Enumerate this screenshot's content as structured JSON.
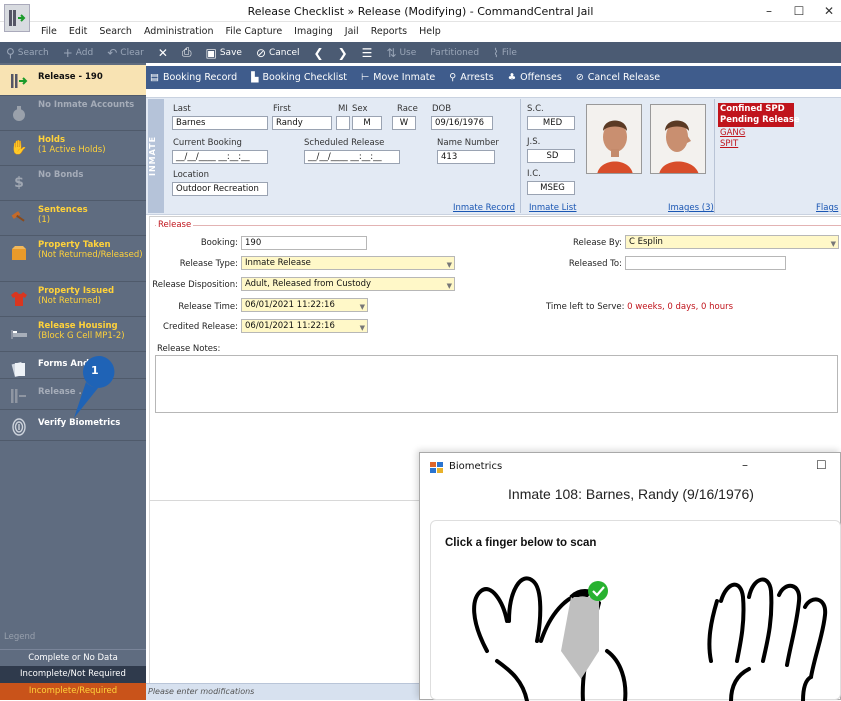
{
  "window": {
    "title": "Release Checklist » Release (Modifying) - CommandCentral Jail",
    "minimize": "–",
    "maximize": "☐",
    "close": "✕"
  },
  "menu": [
    "File",
    "Edit",
    "Search",
    "Administration",
    "File Capture",
    "Imaging",
    "Jail",
    "Reports",
    "Help"
  ],
  "toolbar": {
    "search": "Search",
    "add": "Add",
    "clear": "Clear",
    "save": "Save",
    "cancel": "Cancel",
    "use": "Use",
    "partitioned": "Partitioned",
    "file": "File"
  },
  "actions": {
    "booking_record": "Booking Record",
    "booking_checklist": "Booking Checklist",
    "move_inmate": "Move Inmate",
    "arrests": "Arrests",
    "offenses": "Offenses",
    "cancel_release": "Cancel Release"
  },
  "sidebar": {
    "items": [
      {
        "t1": "Release - 190",
        "t2": ""
      },
      {
        "t1": "No Inmate Accounts",
        "t2": ""
      },
      {
        "t1": "Holds",
        "t2": "(1 Active Holds)"
      },
      {
        "t1": "No Bonds",
        "t2": ""
      },
      {
        "t1": "Sentences",
        "t2": "(1)"
      },
      {
        "t1": "Property Taken",
        "t2": "(Not Returned/Released)"
      },
      {
        "t1": "Property Issued",
        "t2": "(Not Returned)"
      },
      {
        "t1": "Release Housing",
        "t2": "(Block G Cell MP1-2)"
      },
      {
        "t1": "Forms And ...",
        "t2": ""
      },
      {
        "t1": "Release ...e",
        "t2": ""
      },
      {
        "t1": "Verify Biometrics",
        "t2": ""
      }
    ],
    "legend_title": "Legend",
    "legend": [
      "Complete or No Data",
      "Incomplete/Not Required",
      "Incomplete/Required"
    ],
    "callout_number": "1"
  },
  "inmate": {
    "tag": "INMATE",
    "labels": {
      "last": "Last",
      "first": "First",
      "mi": "MI",
      "sex": "Sex",
      "race": "Race",
      "dob": "DOB",
      "current_booking": "Current Booking",
      "scheduled_release": "Scheduled Release",
      "name_number": "Name Number",
      "location": "Location",
      "sc": "S.C.",
      "js": "J.S.",
      "ic": "I.C."
    },
    "last": "Barnes",
    "first": "Randy",
    "mi": "",
    "sex": "M",
    "race": "W",
    "dob": "09/16/1976",
    "current_booking": "__/__/____ __:__:__",
    "scheduled_release": "__/__/____ __:__:__",
    "name_number": "413",
    "location": "Outdoor Recreation",
    "sc": "MED",
    "js": "SD",
    "ic": "MSEG",
    "links": {
      "record": "Inmate Record",
      "list": "Inmate List",
      "images": "Images (3)",
      "flags": "Flags"
    },
    "flags": [
      "Confined SPD",
      "Pending Release",
      "GANG",
      "SPIT"
    ]
  },
  "release": {
    "section": "Release",
    "booking_label": "Booking:",
    "booking": "190",
    "type_label": "Release Type:",
    "type": "Inmate Release",
    "disposition_label": "Release Disposition:",
    "disposition": "Adult, Released from Custody",
    "time_label": "Release Time:",
    "time": "06/01/2021 11:22:16",
    "credited_label": "Credited Release:",
    "credited": "06/01/2021 11:22:16",
    "by_label": "Release By:",
    "by": "C Esplin",
    "to_label": "Released To:",
    "to": "",
    "left_label": "Time left to Serve:",
    "left_value": "0 weeks, 0 days, 0 hours",
    "notes_label": "Release Notes:"
  },
  "status": "Please enter modifications",
  "biometrics": {
    "title": "Biometrics",
    "inmate_line": "Inmate 108: Barnes, Randy (9/16/1976)",
    "instruction": "Click a finger below to scan"
  },
  "colors": {
    "toolbar": "#4b5b73",
    "actionbar": "#3f5c8c",
    "sidebar": "#5f6c80",
    "accent_yellow": "#ffd23a",
    "flag_red": "#c0141c"
  }
}
